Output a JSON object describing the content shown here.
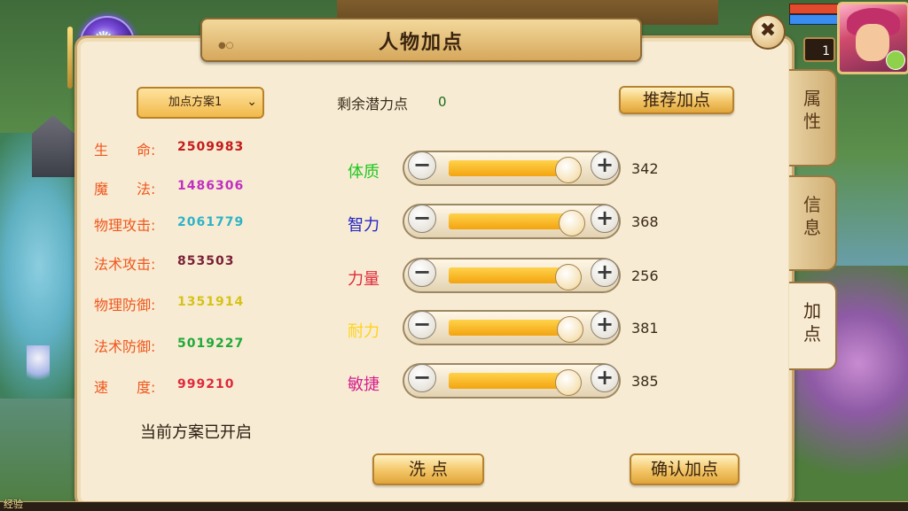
{
  "window": {
    "title": "人物加点",
    "close_glyph": "✖"
  },
  "player": {
    "level": "1"
  },
  "tabs": [
    {
      "label_top": "属",
      "label_bottom": "性",
      "active": false
    },
    {
      "label_top": "信",
      "label_bottom": "息",
      "active": false
    },
    {
      "label_top": "加",
      "label_bottom": "点",
      "active": true
    }
  ],
  "scheme": {
    "selected": "加点方案1",
    "status": "当前方案已开启"
  },
  "potential": {
    "label": "剩余潜力点",
    "value": "0"
  },
  "buttons": {
    "recommend": "推荐加点",
    "reset": "洗 点",
    "confirm": "确认加点"
  },
  "stats": [
    {
      "label": "生　　命:",
      "value": "2509983",
      "label_color": "#f0561e",
      "value_color": "#c41a1a"
    },
    {
      "label": "魔　　法:",
      "value": "1486306",
      "label_color": "#f0561e",
      "value_color": "#c12fc1"
    },
    {
      "label": "物理攻击:",
      "value": "2061779",
      "label_color": "#f0561e",
      "value_color": "#2fb2c7"
    },
    {
      "label": "法术攻击:",
      "value": "853503",
      "label_color": "#f0561e",
      "value_color": "#7a1f35"
    },
    {
      "label": "物理防御:",
      "value": "1351914",
      "label_color": "#f0561e",
      "value_color": "#d6c21a"
    },
    {
      "label": "法术防御:",
      "value": "5019227",
      "label_color": "#f0561e",
      "value_color": "#21a83a"
    },
    {
      "label": "速　　度:",
      "value": "999210",
      "label_color": "#f0561e",
      "value_color": "#e0283b"
    }
  ],
  "attributes": [
    {
      "name": "体质",
      "value": "342",
      "color": "#23c623",
      "fill": 0.79
    },
    {
      "name": "智力",
      "value": "368",
      "color": "#2424c6",
      "fill": 0.81
    },
    {
      "name": "力量",
      "value": "256",
      "color": "#e0283b",
      "fill": 0.79
    },
    {
      "name": "耐力",
      "value": "381",
      "color": "#ffd21a",
      "fill": 0.8
    },
    {
      "name": "敏捷",
      "value": "385",
      "color": "#d6208e",
      "fill": 0.79
    }
  ],
  "xp": {
    "label": "经验"
  }
}
